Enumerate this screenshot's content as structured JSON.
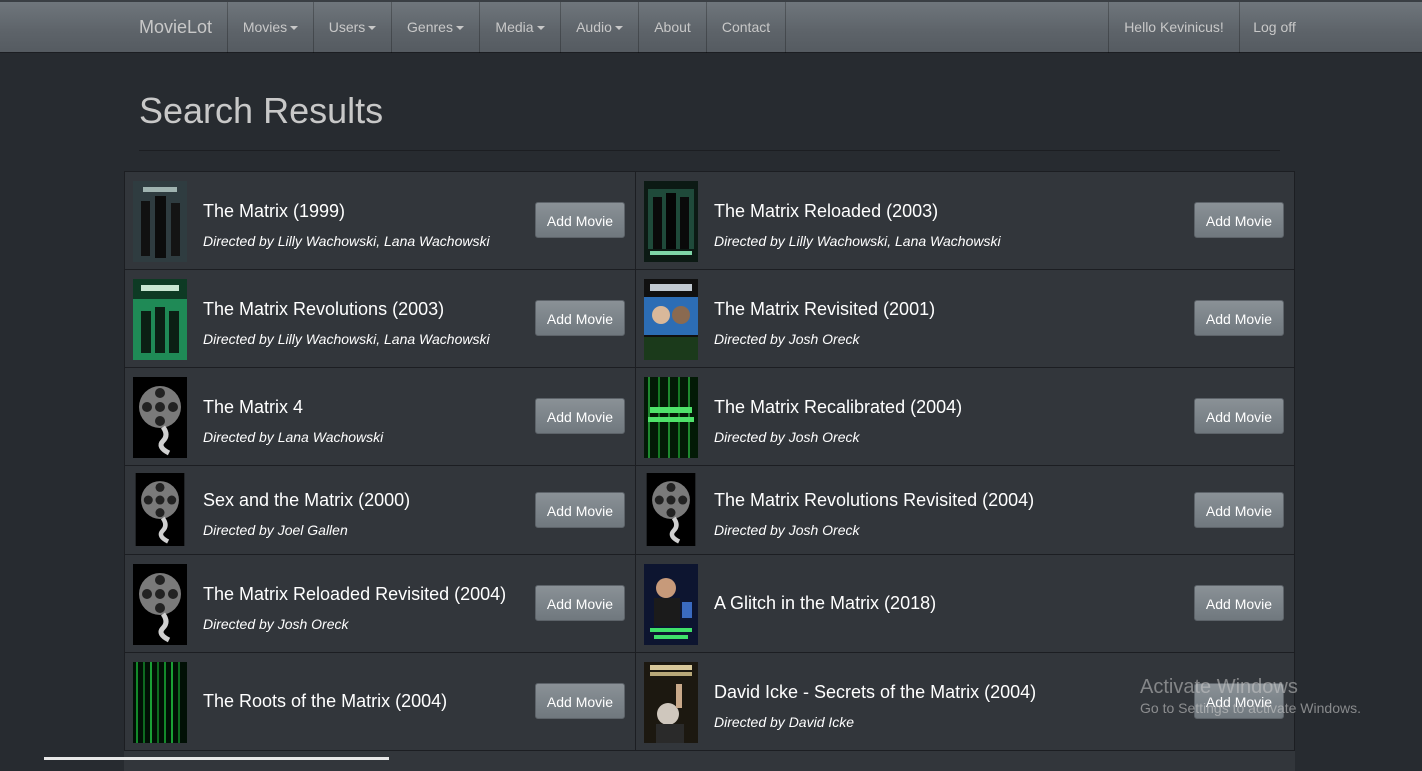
{
  "navbar": {
    "brand": "MovieLot",
    "items": [
      {
        "label": "Movies",
        "dropdown": true
      },
      {
        "label": "Users",
        "dropdown": true
      },
      {
        "label": "Genres",
        "dropdown": true
      },
      {
        "label": "Media",
        "dropdown": true
      },
      {
        "label": "Audio",
        "dropdown": true
      },
      {
        "label": "About",
        "dropdown": false
      },
      {
        "label": "Contact",
        "dropdown": false
      }
    ],
    "greeting": "Hello Kevinicus!",
    "logoff": "Log off"
  },
  "page": {
    "title": "Search Results"
  },
  "results": [
    {
      "title": "The Matrix (1999)",
      "director": "Directed by Lilly Wachowski, Lana Wachowski",
      "button": "Add Movie",
      "poster": "matrix-poster"
    },
    {
      "title": "The Matrix Reloaded (2003)",
      "director": "Directed by Lilly Wachowski, Lana Wachowski",
      "button": "Add Movie",
      "poster": "matrix-reloaded-poster"
    },
    {
      "title": "The Matrix Revolutions (2003)",
      "director": "Directed by Lilly Wachowski, Lana Wachowski",
      "button": "Add Movie",
      "poster": "matrix-revolutions-poster"
    },
    {
      "title": "The Matrix Revisited (2001)",
      "director": "Directed by Josh Oreck",
      "button": "Add Movie",
      "poster": "matrix-revisited-poster"
    },
    {
      "title": "The Matrix 4",
      "director": "Directed by Lana Wachowski",
      "button": "Add Movie",
      "poster": "film-reel-placeholder"
    },
    {
      "title": "The Matrix Recalibrated (2004)",
      "director": "Directed by Josh Oreck",
      "button": "Add Movie",
      "poster": "matrix-recalibrated-poster"
    },
    {
      "title": "Sex and the Matrix (2000)",
      "director": "Directed by Joel Gallen",
      "button": "Add Movie",
      "poster": "film-reel-placeholder"
    },
    {
      "title": "The Matrix Revolutions Revisited (2004)",
      "director": "Directed by Josh Oreck",
      "button": "Add Movie",
      "poster": "film-reel-placeholder"
    },
    {
      "title": "The Matrix Reloaded Revisited (2004)",
      "director": "Directed by Josh Oreck",
      "button": "Add Movie",
      "poster": "film-reel-placeholder"
    },
    {
      "title": "A Glitch in the Matrix (2018)",
      "director": "",
      "button": "Add Movie",
      "poster": "glitch-poster"
    },
    {
      "title": "The Roots of the Matrix (2004)",
      "director": "",
      "button": "Add Movie",
      "poster": "code-rain-poster"
    },
    {
      "title": "David Icke - Secrets of the Matrix (2004)",
      "director": "Directed by David Icke",
      "button": "Add Movie",
      "poster": "david-icke-poster"
    }
  ],
  "watermark": {
    "line1": "Activate Windows",
    "line2": "Go to Settings to activate Windows."
  },
  "colors": {
    "background": "#272b30",
    "panel": "#32363b",
    "navbar": "#5d6369",
    "button": "#7a8288"
  }
}
